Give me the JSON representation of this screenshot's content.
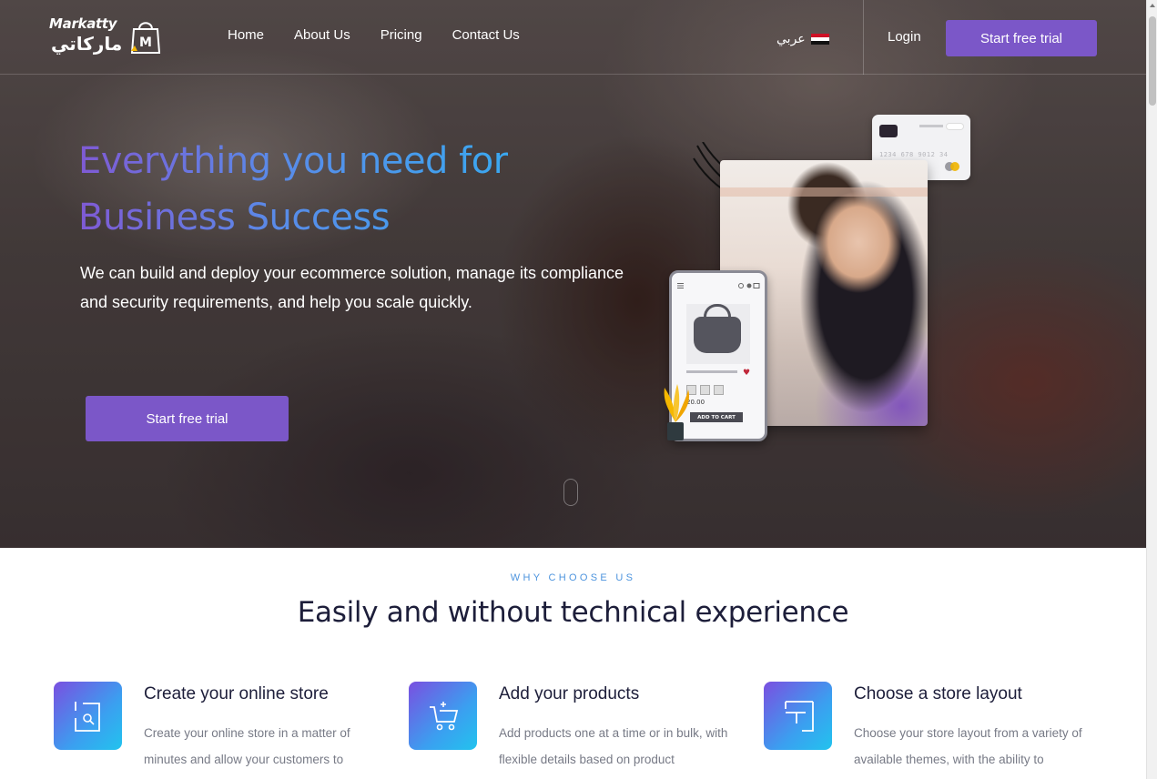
{
  "brand": {
    "name_en": "Markatty",
    "name_ar": "ماركاتي",
    "accent": "#7b57c8"
  },
  "nav": {
    "links": [
      "Home",
      "About Us",
      "Pricing",
      "Contact Us"
    ],
    "language_label": "عربي",
    "flag_icon": "egypt-flag-icon",
    "login_label": "Login",
    "cta_label": "Start free trial"
  },
  "hero": {
    "title_line1": "Everything you need for",
    "title_line2": "Business Success",
    "subtitle": "We can build and deploy your ecommerce solution, manage its compliance and security requirements, and help you scale quickly.",
    "cta_label": "Start free trial",
    "phone_price": "20.00",
    "phone_cart_label": "ADD TO CART",
    "card_numbers": "1234  678  9012  34"
  },
  "why": {
    "eyebrow": "WHY CHOOSE US",
    "title": "Easily and without technical experience",
    "features": [
      {
        "icon": "store-icon",
        "title": "Create your online store",
        "description": "Create your online store in a matter of minutes and allow your customers to"
      },
      {
        "icon": "cart-icon",
        "title": "Add your products",
        "description": "Add products one at a time or in bulk, with flexible details based on product"
      },
      {
        "icon": "layout-icon",
        "title": "Choose a store layout",
        "description": "Choose your store layout from a variety of available themes, with the ability to"
      }
    ]
  }
}
